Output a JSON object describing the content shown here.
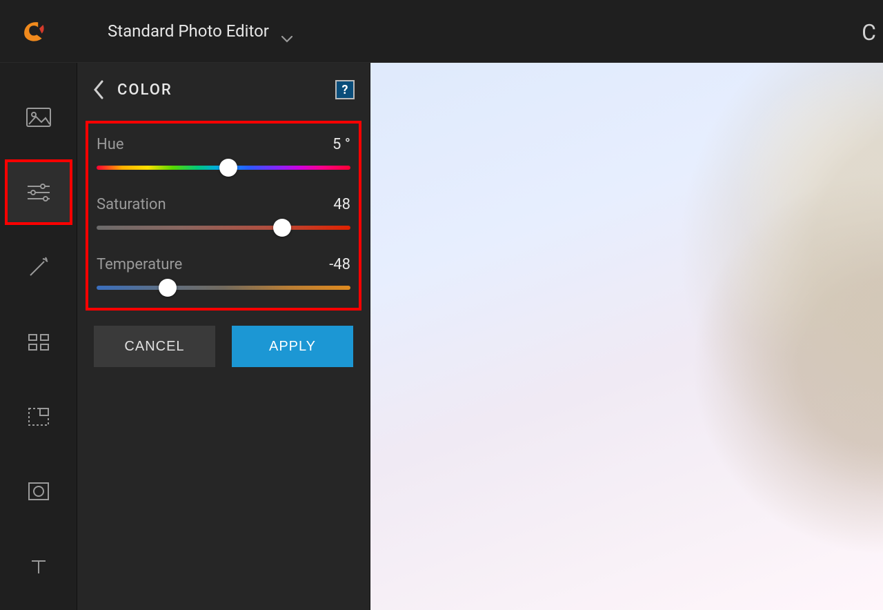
{
  "header": {
    "title": "Standard Photo Editor"
  },
  "panel": {
    "title": "COLOR",
    "help_label": "?",
    "sliders": {
      "hue": {
        "label": "Hue",
        "value": "5 °",
        "position": 52
      },
      "saturation": {
        "label": "Saturation",
        "value": "48",
        "position": 73
      },
      "temperature": {
        "label": "Temperature",
        "value": "-48",
        "position": 28
      }
    },
    "cancel_label": "CANCEL",
    "apply_label": "APPLY"
  },
  "rail": {
    "items": [
      {
        "name": "image",
        "active": false
      },
      {
        "name": "sliders",
        "active": true
      },
      {
        "name": "wand",
        "active": false
      },
      {
        "name": "grid",
        "active": false
      },
      {
        "name": "resize",
        "active": false
      },
      {
        "name": "shape",
        "active": false
      },
      {
        "name": "text",
        "active": false
      }
    ]
  },
  "colors": {
    "accent": "#1c97d4",
    "highlight": "#ff0000"
  }
}
